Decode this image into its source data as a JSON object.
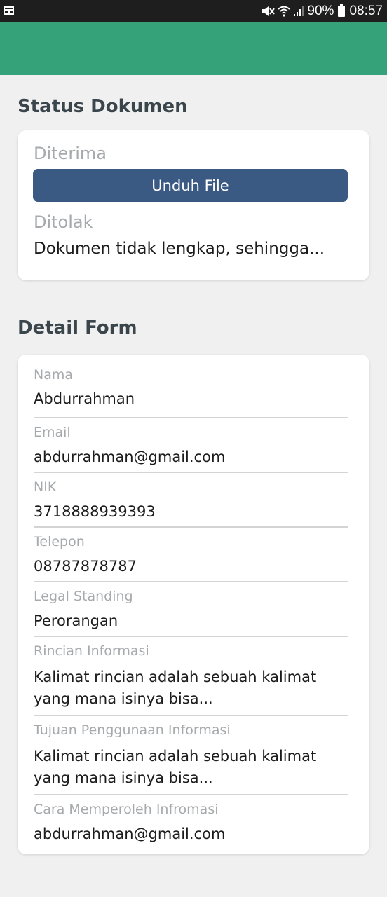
{
  "status_bar": {
    "battery": "90%",
    "time": "08:57"
  },
  "status_section": {
    "title": "Status Dokumen",
    "accepted_label": "Diterima",
    "download_button": "Unduh File",
    "rejected_label": "Ditolak",
    "rejection_note": "Dokumen tidak lengkap, sehingga..."
  },
  "detail_section": {
    "title": "Detail Form",
    "fields": [
      {
        "label": "Nama",
        "value": "Abdurrahman"
      },
      {
        "label": "Email",
        "value": "abdurrahman@gmail.com"
      },
      {
        "label": "NIK",
        "value": "3718888939393"
      },
      {
        "label": "Telepon",
        "value": "08787878787"
      },
      {
        "label": "Legal Standing",
        "value": "Perorangan"
      },
      {
        "label": "Rincian Informasi",
        "value": "Kalimat rincian adalah sebuah kalimat yang mana isinya bisa..."
      },
      {
        "label": "Tujuan Penggunaan Informasi",
        "value": "Kalimat rincian adalah sebuah kalimat yang mana isinya bisa..."
      },
      {
        "label": "Cara Memperoleh Infromasi",
        "value": "abdurrahman@gmail.com"
      }
    ]
  },
  "colors": {
    "app_bar": "#35a27a",
    "button": "#3a5a84",
    "background": "#f0f0f0"
  }
}
